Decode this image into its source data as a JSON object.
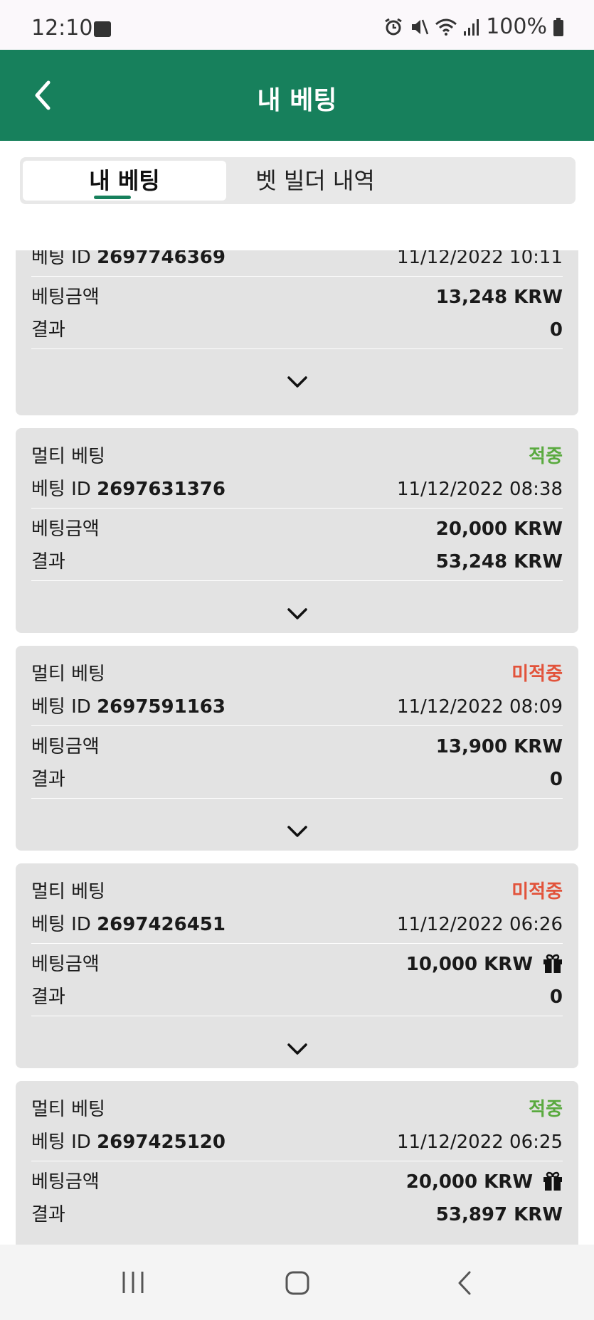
{
  "status": {
    "time": "12:10",
    "battery": "100%"
  },
  "header": {
    "title": "내 베팅"
  },
  "tabs": [
    {
      "label": "내 베팅",
      "active": true
    },
    {
      "label": "벳 빌더 내역",
      "active": false
    }
  ],
  "labels": {
    "bet_id": "베팅 ID",
    "amount": "베팅금액",
    "result": "결과"
  },
  "bets": [
    {
      "type": "",
      "status": "",
      "id": "2697746369",
      "datetime": "11/12/2022 10:11",
      "amount": "13,248 KRW",
      "result": "0",
      "gift": false
    },
    {
      "type": "멀티 베팅",
      "status": "적중",
      "id": "2697631376",
      "datetime": "11/12/2022 08:38",
      "amount": "20,000 KRW",
      "result": "53,248 KRW",
      "gift": false
    },
    {
      "type": "멀티 베팅",
      "status": "미적중",
      "id": "2697591163",
      "datetime": "11/12/2022 08:09",
      "amount": "13,900 KRW",
      "result": "0",
      "gift": false
    },
    {
      "type": "멀티 베팅",
      "status": "미적중",
      "id": "2697426451",
      "datetime": "11/12/2022 06:26",
      "amount": "10,000 KRW",
      "result": "0",
      "gift": true
    },
    {
      "type": "멀티 베팅",
      "status": "적중",
      "id": "2697425120",
      "datetime": "11/12/2022 06:25",
      "amount": "20,000 KRW",
      "result": "53,897 KRW",
      "gift": true
    }
  ],
  "colors": {
    "header": "#17805c",
    "hit": "#5aaa3f",
    "miss": "#e2533b",
    "card": "#e3e3e3"
  }
}
